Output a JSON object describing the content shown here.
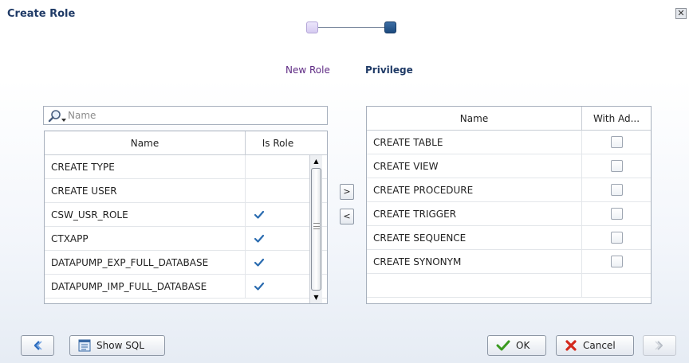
{
  "dialog": {
    "title": "Create Role",
    "close_glyph": "✕"
  },
  "train": {
    "steps": [
      {
        "label": "New Role",
        "state": "visited"
      },
      {
        "label": "Privilege",
        "state": "current"
      }
    ]
  },
  "search": {
    "placeholder": "Name",
    "value": ""
  },
  "available_table": {
    "columns": [
      "Name",
      "Is Role"
    ],
    "rows": [
      {
        "name": "CREATE TYPE",
        "is_role": false
      },
      {
        "name": "CREATE USER",
        "is_role": false
      },
      {
        "name": "CSW_USR_ROLE",
        "is_role": true
      },
      {
        "name": "CTXAPP",
        "is_role": true
      },
      {
        "name": "DATAPUMP_EXP_FULL_DATABASE",
        "is_role": true
      },
      {
        "name": "DATAPUMP_IMP_FULL_DATABASE",
        "is_role": true
      }
    ]
  },
  "shuttle": {
    "move_right": ">",
    "move_left": "<"
  },
  "selected_table": {
    "columns": [
      "Name",
      "With Ad..."
    ],
    "rows": [
      {
        "name": "CREATE TABLE",
        "with_admin": false
      },
      {
        "name": "CREATE VIEW",
        "with_admin": false
      },
      {
        "name": "CREATE PROCEDURE",
        "with_admin": false
      },
      {
        "name": "CREATE TRIGGER",
        "with_admin": false
      },
      {
        "name": "CREATE SEQUENCE",
        "with_admin": false
      },
      {
        "name": "CREATE SYNONYM",
        "with_admin": false
      }
    ]
  },
  "footer": {
    "show_sql": "Show SQL",
    "ok": "OK",
    "cancel": "Cancel"
  },
  "colors": {
    "title": "#1f3a66",
    "visited_step": "#5f2b84",
    "check": "#2b6cb0",
    "ok_icon": "#3a9a1f",
    "cancel_icon": "#d42a1e"
  }
}
